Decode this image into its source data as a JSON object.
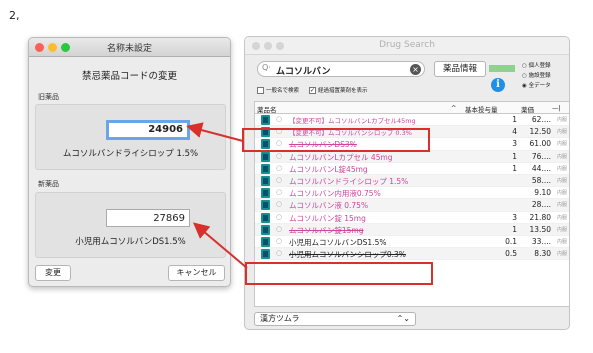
{
  "lead_text": "2,",
  "dialog": {
    "title": "名称未設定",
    "heading": "禁忌薬品コードの変更",
    "old_label": "旧薬品",
    "old_code": "24906",
    "old_name": "ムコソルバンドライシロップ 1.5%",
    "new_label": "新薬品",
    "new_code": "27869",
    "new_name": "小児用ムコソルバンDS1.5%",
    "change_button": "変更",
    "cancel_button": "キャンセル"
  },
  "search_window": {
    "title": "Drug Search",
    "search_value": "ムコソルバン",
    "info_button": "薬品情報",
    "radios": [
      "個人登録",
      "施設登録",
      "全データ"
    ],
    "checkbox_generic": "一般名で検索",
    "checkbox_past": "経過措置薬剤を表示",
    "headers": {
      "name": "薬品名",
      "dose": "基本投与量",
      "price": "薬価"
    },
    "rows": [
      {
        "name": "【変更不可】ムコソルバンLカプセル45mg",
        "dose": "1",
        "price": "62....",
        "mark": "内服",
        "color": "#d0449a",
        "style": "small"
      },
      {
        "name": "【変更不可】ムコソルバンシロップ 0.3%",
        "dose": "4",
        "price": "12.50",
        "mark": "内服",
        "color": "#d0449a",
        "style": "small"
      },
      {
        "name": "ムコソルバンDS3%",
        "dose": "3",
        "price": "61.00",
        "mark": "内服",
        "color": "#d0449a",
        "style": "strike"
      },
      {
        "name": "ムコソルバンLカプセル 45mg",
        "dose": "1",
        "price": "76....",
        "mark": "内服",
        "color": "#d0449a",
        "style": ""
      },
      {
        "name": "ムコソルバンL錠45mg",
        "dose": "1",
        "price": "44....",
        "mark": "内服",
        "color": "#d0449a",
        "style": ""
      },
      {
        "name": "ムコソルバンドライシロップ 1.5%",
        "dose": "",
        "price": "58....",
        "mark": "内服",
        "color": "#d0449a",
        "style": ""
      },
      {
        "name": "ムコソルバン内用液0.75%",
        "dose": "",
        "price": "9.10",
        "mark": "内服",
        "color": "#d0449a",
        "style": ""
      },
      {
        "name": "ムコソルバン液 0.75%",
        "dose": "",
        "price": "28....",
        "mark": "内服",
        "color": "#d0449a",
        "style": ""
      },
      {
        "name": "ムコソルバン錠 15mg",
        "dose": "3",
        "price": "21.80",
        "mark": "内服",
        "color": "#d0449a",
        "style": ""
      },
      {
        "name": "ムコソルバン錠15mg",
        "dose": "1",
        "price": "13.50",
        "mark": "内服",
        "color": "#d0449a",
        "style": "strike"
      },
      {
        "name": "小児用ムコソルバンDS1.5%",
        "dose": "0.1",
        "price": "33....",
        "mark": "内服",
        "color": "#222222",
        "style": ""
      },
      {
        "name": "小児用ムコソルバンシロップ0.3%",
        "dose": "0.5",
        "price": "8.30",
        "mark": "内服",
        "color": "#222222",
        "style": "strike"
      }
    ],
    "combo_value": "漢方ツムラ"
  },
  "colors": {
    "highlight": "#d8302b",
    "accent_blue": "#1f8fe8",
    "drug_pink": "#d0449a"
  }
}
